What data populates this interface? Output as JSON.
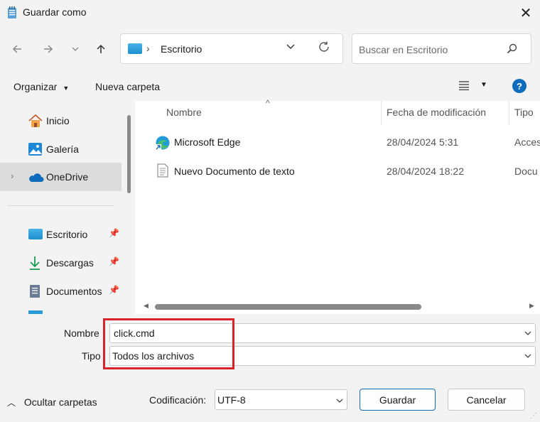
{
  "window": {
    "title": "Guardar como",
    "close_glyph": "✕"
  },
  "nav": {
    "back_icon": "arrow-left-icon",
    "forward_icon": "arrow-right-icon",
    "recent_icon": "chevron-down-icon",
    "up_icon": "arrow-up-icon",
    "address": "Escritorio",
    "search_placeholder": "Buscar en Escritorio"
  },
  "toolbar": {
    "organize": "Organizar",
    "new_folder": "Nueva carpeta",
    "help": "?"
  },
  "sidebar": {
    "items": [
      {
        "label": "Inicio",
        "icon": "home-icon"
      },
      {
        "label": "Galería",
        "icon": "gallery-icon"
      },
      {
        "label": "OneDrive",
        "icon": "onedrive-icon"
      },
      {
        "label": "Escritorio",
        "icon": "desktop-folder-icon"
      },
      {
        "label": "Descargas",
        "icon": "download-icon"
      },
      {
        "label": "Documentos",
        "icon": "documents-icon"
      }
    ]
  },
  "columns": {
    "name": "Nombre",
    "date": "Fecha de modificación",
    "type": "Tipo"
  },
  "files": [
    {
      "name": "Microsoft Edge",
      "date": "28/04/2024 5:31",
      "type": "Acces",
      "icon": "edge-shortcut-icon"
    },
    {
      "name": "Nuevo Documento de texto",
      "date": "28/04/2024 18:22",
      "type": "Docu",
      "icon": "text-file-icon"
    }
  ],
  "form": {
    "name_label": "Nombre",
    "name_value": "click.cmd",
    "type_label": "Tipo",
    "type_value": "Todos los archivos",
    "encoding_label": "Codificación:",
    "encoding_value": "UTF-8"
  },
  "actions": {
    "hide_folders": "Ocultar carpetas",
    "save": "Guardar",
    "cancel": "Cancelar"
  },
  "colors": {
    "accent": "#0f6cbd",
    "highlight": "#d9222a",
    "chrome": "#f3f3f3"
  }
}
